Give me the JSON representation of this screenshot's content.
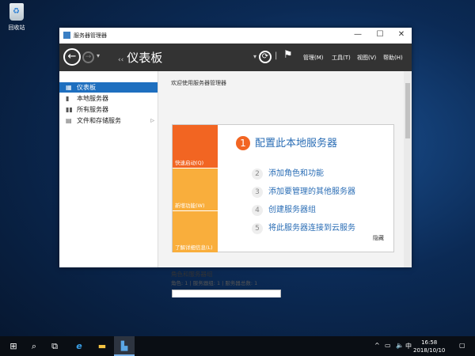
{
  "desktop": {
    "recycle_bin": "回收站"
  },
  "window": {
    "title": "服务器管理器",
    "minimize": "—",
    "maximize": "☐",
    "close": "✕"
  },
  "toolbar": {
    "breadcrumb": "仪表板",
    "menus": [
      "管理(M)",
      "工具(T)",
      "视图(V)",
      "帮助(H)"
    ]
  },
  "nav": {
    "items": [
      {
        "label": "仪表板",
        "icon": "dashboard-icon",
        "selected": true
      },
      {
        "label": "本地服务器",
        "icon": "server-icon"
      },
      {
        "label": "所有服务器",
        "icon": "servers-icon"
      },
      {
        "label": "文件和存储服务",
        "icon": "storage-icon",
        "expandable": true
      }
    ]
  },
  "content": {
    "welcome": "欢迎使用服务器管理器",
    "quick_start": {
      "tiles": [
        "快速启动(Q)",
        "新增功能(W)",
        "了解详细信息(L)"
      ],
      "main_step": {
        "number": "1",
        "label": "配置此本地服务器"
      },
      "steps": [
        {
          "number": "2",
          "label": "添加角色和功能"
        },
        {
          "number": "3",
          "label": "添加要管理的其他服务器"
        },
        {
          "number": "4",
          "label": "创建服务器组"
        },
        {
          "number": "5",
          "label": "将此服务器连接到云服务"
        }
      ],
      "hide": "隐藏"
    },
    "roles_title": "角色和服务器组",
    "roles_summary": "角色: 1 | 服务器组: 1 | 服务器总数: 1"
  },
  "taskbar": {
    "time": "16:58",
    "date": "2018/10/10",
    "ime": "中"
  },
  "colors": {
    "accent_orange": "#f26522",
    "tile_yellow": "#f9ae3c",
    "selection": "#1e6fbf",
    "toolbar": "#333333",
    "link": "#2a6db5"
  }
}
